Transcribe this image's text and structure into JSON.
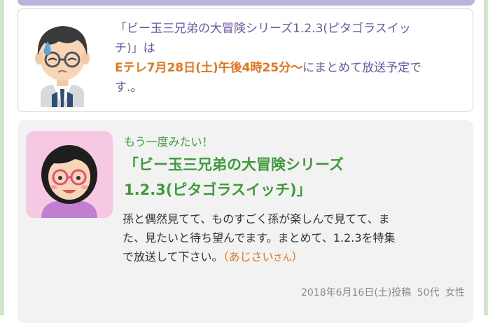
{
  "answer": {
    "line1": "「ビー玉三兄弟の大冒険シリーズ1.2.3(ピタゴラスイッ",
    "line2": "チ)」は",
    "highlight": "Eテレ7月28日(土)午後4時25分〜",
    "line3_rest": "にまとめて放送予定で",
    "line4": "す.。"
  },
  "request": {
    "lead": "もう一度みたい！",
    "title_line1": "「ビー玉三兄弟の大冒険シリーズ",
    "title_line2": "1.2.3(ピタゴラスイッチ)」",
    "body_line1": "孫と偶然見てて、ものすごく孫が楽しんで見てて、ま",
    "body_line2": "た、見たいと待ち望んでます。まとめて、1.2.3を特集",
    "body_line3": "で放送して下さい。",
    "author_open": "（あじさい",
    "author_suffix": "さん",
    "author_close": "）",
    "meta_date": "2018年6月16日(土)投稿",
    "meta_age": "50代",
    "meta_gender": "女性"
  },
  "colors": {
    "purple_text": "#6e55a8",
    "orange_highlight": "#e2761f",
    "green_title": "#3f9b3a",
    "topbar": "#b7b5dc",
    "avatar_bg_pink": "#f6c8e1"
  },
  "icons": {
    "answer_avatar": "worried-man-avatar-icon",
    "request_avatar": "woman-with-glasses-avatar-icon"
  }
}
